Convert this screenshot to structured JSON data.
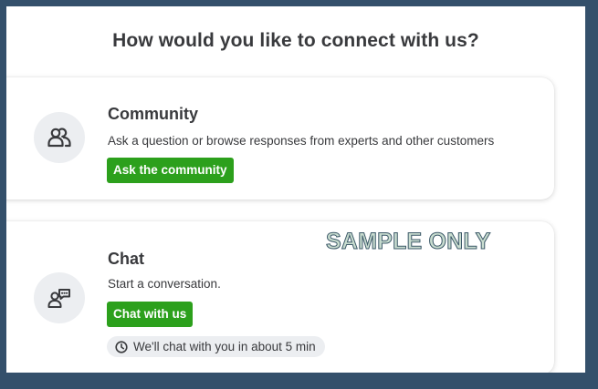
{
  "heading": "How would you like to connect with us?",
  "community": {
    "icon": "people-icon",
    "title": "Community",
    "description": "Ask a question or browse responses from experts and other customers",
    "button_label": "Ask the community"
  },
  "chat": {
    "icon": "chat-agent-icon",
    "title": "Chat",
    "description": "Start a conversation.",
    "button_label": "Chat with us",
    "wait_icon": "clock-icon",
    "wait_text": "We'll chat with you in about 5 min"
  },
  "watermark": "SAMPLE ONLY",
  "colors": {
    "accent_green": "#2ca01c",
    "frame_border": "#34506b",
    "text": "#393a3d",
    "icon_bg": "#eceef1"
  }
}
